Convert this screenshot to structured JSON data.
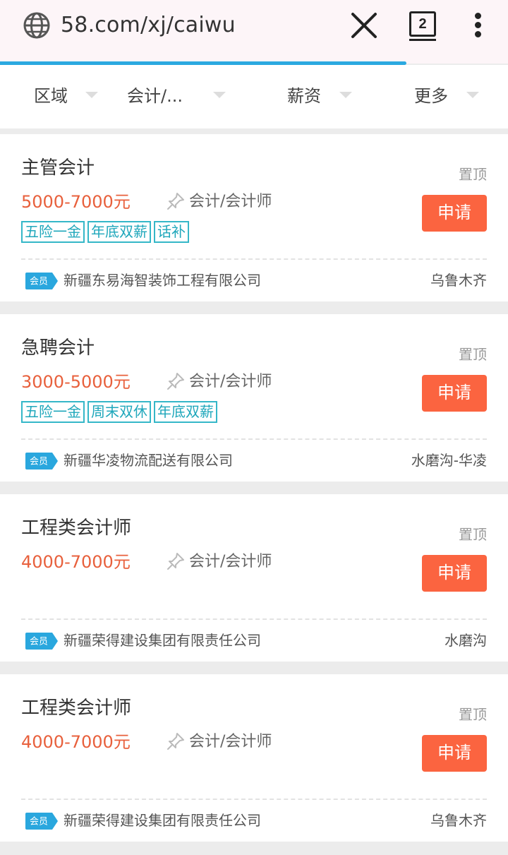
{
  "browser": {
    "url": "58.com/xj/caiwu",
    "tab_count": "2",
    "load_progress_percent": 80,
    "accent": "#2ba9e0"
  },
  "filters": [
    {
      "label": "区域"
    },
    {
      "label": "会计/..."
    },
    {
      "label": "薪资"
    },
    {
      "label": "更多"
    }
  ],
  "colors": {
    "salary": "#e8603c",
    "apply_button": "#fb6440",
    "tag_border": "#35b7c8",
    "member_badge": "#2aa7de"
  },
  "jobs": [
    {
      "title": "主管会计",
      "pin": "置顶",
      "salary": "5000-7000元",
      "category": "会计/会计师",
      "apply": "申请",
      "tags": [
        "五险一金",
        "年底双薪",
        "话补"
      ],
      "badge": "会员",
      "company": "新疆东易海智装饰工程有限公司",
      "location": "乌鲁木齐"
    },
    {
      "title": "急聘会计",
      "pin": "置顶",
      "salary": "3000-5000元",
      "category": "会计/会计师",
      "apply": "申请",
      "tags": [
        "五险一金",
        "周末双休",
        "年底双薪"
      ],
      "badge": "会员",
      "company": "新疆华凌物流配送有限公司",
      "location": "水磨沟-华凌"
    },
    {
      "title": "工程类会计师",
      "pin": "置顶",
      "salary": "4000-7000元",
      "category": "会计/会计师",
      "apply": "申请",
      "tags": [],
      "badge": "会员",
      "company": "新疆荣得建设集团有限责任公司",
      "location": "水磨沟"
    },
    {
      "title": "工程类会计师",
      "pin": "置顶",
      "salary": "4000-7000元",
      "category": "会计/会计师",
      "apply": "申请",
      "tags": [],
      "badge": "会员",
      "company": "新疆荣得建设集团有限责任公司",
      "location": "乌鲁木齐"
    }
  ]
}
